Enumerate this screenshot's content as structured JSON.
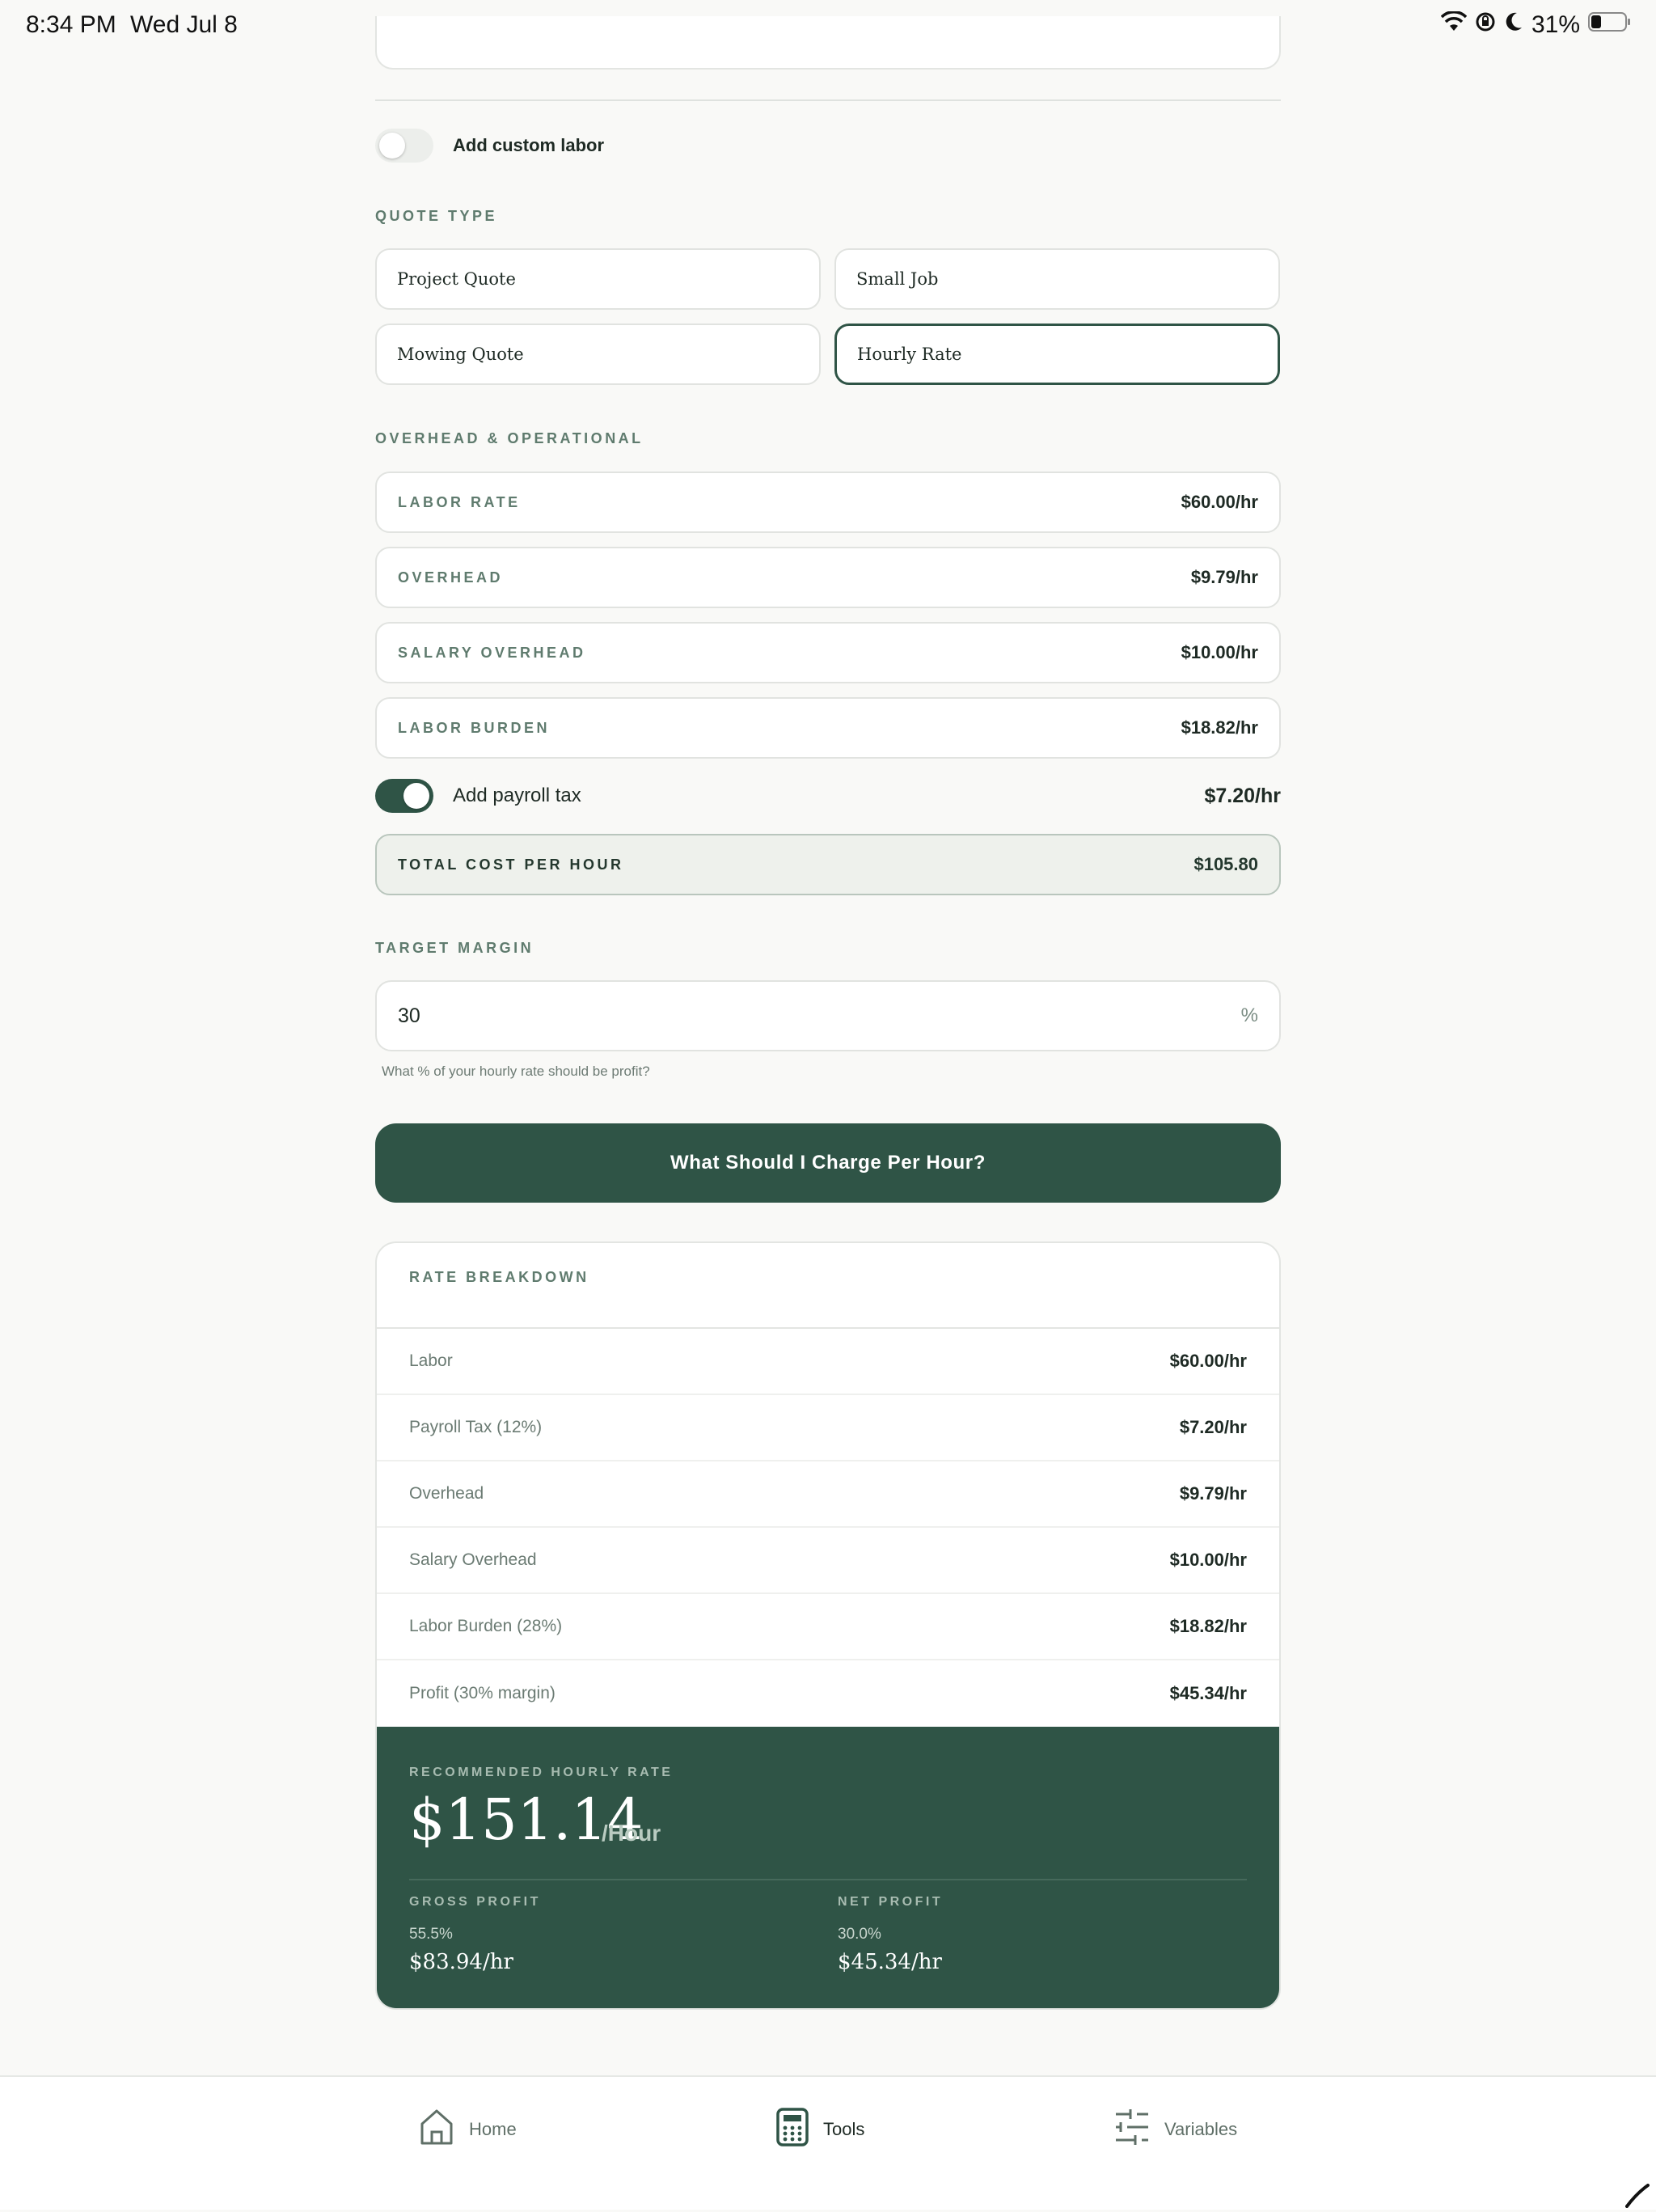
{
  "status_bar": {
    "time": "8:34 PM",
    "date": "Wed Jul 8",
    "battery": "31%"
  },
  "custom_labor": {
    "label": "Add custom labor",
    "enabled": false
  },
  "quote_type": {
    "label": "QUOTE TYPE",
    "options": [
      "Project Quote",
      "Small Job",
      "Mowing Quote",
      "Hourly Rate"
    ],
    "selected": "Hourly Rate"
  },
  "overhead": {
    "label": "OVERHEAD & OPERATIONAL",
    "rows": [
      {
        "label": "LABOR RATE",
        "value": "$60.00/hr"
      },
      {
        "label": "OVERHEAD",
        "value": "$9.79/hr"
      },
      {
        "label": "SALARY OVERHEAD",
        "value": "$10.00/hr"
      },
      {
        "label": "LABOR BURDEN",
        "value": "$18.82/hr"
      }
    ],
    "payroll_tax": {
      "label": "Add payroll tax",
      "value": "$7.20/hr",
      "enabled": true
    },
    "total": {
      "label": "TOTAL COST PER HOUR",
      "value": "$105.80"
    }
  },
  "target_margin": {
    "label": "TARGET MARGIN",
    "value": "30",
    "unit": "%",
    "help": "What % of your hourly rate should be profit?"
  },
  "cta_label": "What Should I Charge Per Hour?",
  "breakdown": {
    "title": "RATE BREAKDOWN",
    "rows": [
      {
        "name": "Labor",
        "value": "$60.00/hr"
      },
      {
        "name": "Payroll Tax (12%)",
        "value": "$7.20/hr"
      },
      {
        "name": "Overhead",
        "value": "$9.79/hr"
      },
      {
        "name": "Salary Overhead",
        "value": "$10.00/hr"
      },
      {
        "name": "Labor Burden (28%)",
        "value": "$18.82/hr"
      },
      {
        "name": "Profit (30% margin)",
        "value": "$45.34/hr"
      }
    ]
  },
  "result": {
    "label": "RECOMMENDED HOURLY RATE",
    "price": "$151.14",
    "unit": "/Hour",
    "gross": {
      "label": "GROSS PROFIT",
      "pct": "55.5%",
      "value": "$83.94/hr"
    },
    "net": {
      "label": "NET PROFIT",
      "pct": "30.0%",
      "value": "$45.34/hr"
    }
  },
  "tabbar": {
    "items": [
      {
        "label": "Home",
        "icon": "home-icon"
      },
      {
        "label": "Tools",
        "icon": "calculator-icon",
        "active": true
      },
      {
        "label": "Variables",
        "icon": "sliders-icon"
      }
    ]
  },
  "colors": {
    "accent": "#2f5446",
    "background": "#f9f9f7"
  }
}
